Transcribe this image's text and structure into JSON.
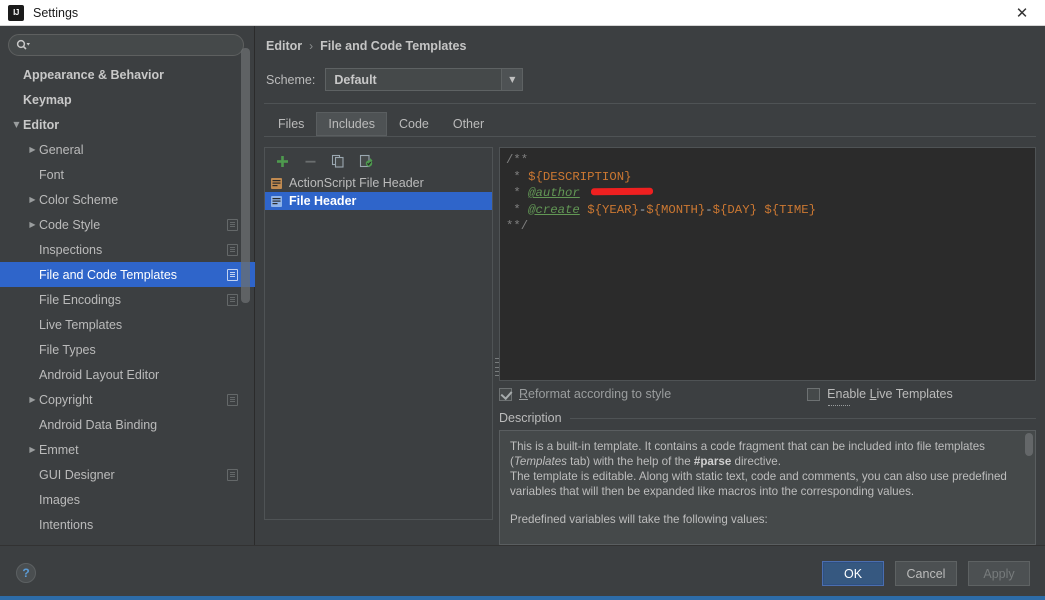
{
  "window": {
    "title": "Settings",
    "app_icon": "intellij-logo-icon",
    "close_icon": "✕"
  },
  "sidebar": {
    "search": {
      "placeholder": "",
      "value": "",
      "icon": "search-icon"
    },
    "items": [
      {
        "label": "Appearance & Behavior",
        "indent": 0,
        "arrow": "",
        "bold": true,
        "selected": false,
        "badge": false
      },
      {
        "label": "Keymap",
        "indent": 0,
        "arrow": "",
        "bold": true,
        "selected": false,
        "badge": false
      },
      {
        "label": "Editor",
        "indent": 0,
        "arrow": "▼",
        "bold": true,
        "selected": false,
        "badge": false
      },
      {
        "label": "General",
        "indent": 1,
        "arrow": "▶",
        "bold": false,
        "selected": false,
        "badge": false
      },
      {
        "label": "Font",
        "indent": 1,
        "arrow": "",
        "bold": false,
        "selected": false,
        "badge": false
      },
      {
        "label": "Color Scheme",
        "indent": 1,
        "arrow": "▶",
        "bold": false,
        "selected": false,
        "badge": false
      },
      {
        "label": "Code Style",
        "indent": 1,
        "arrow": "▶",
        "bold": false,
        "selected": false,
        "badge": true
      },
      {
        "label": "Inspections",
        "indent": 1,
        "arrow": "",
        "bold": false,
        "selected": false,
        "badge": true
      },
      {
        "label": "File and Code Templates",
        "indent": 1,
        "arrow": "",
        "bold": false,
        "selected": true,
        "badge": true
      },
      {
        "label": "File Encodings",
        "indent": 1,
        "arrow": "",
        "bold": false,
        "selected": false,
        "badge": true
      },
      {
        "label": "Live Templates",
        "indent": 1,
        "arrow": "",
        "bold": false,
        "selected": false,
        "badge": false
      },
      {
        "label": "File Types",
        "indent": 1,
        "arrow": "",
        "bold": false,
        "selected": false,
        "badge": false
      },
      {
        "label": "Android Layout Editor",
        "indent": 1,
        "arrow": "",
        "bold": false,
        "selected": false,
        "badge": false
      },
      {
        "label": "Copyright",
        "indent": 1,
        "arrow": "▶",
        "bold": false,
        "selected": false,
        "badge": true
      },
      {
        "label": "Android Data Binding",
        "indent": 1,
        "arrow": "",
        "bold": false,
        "selected": false,
        "badge": false
      },
      {
        "label": "Emmet",
        "indent": 1,
        "arrow": "▶",
        "bold": false,
        "selected": false,
        "badge": false
      },
      {
        "label": "GUI Designer",
        "indent": 1,
        "arrow": "",
        "bold": false,
        "selected": false,
        "badge": true
      },
      {
        "label": "Images",
        "indent": 1,
        "arrow": "",
        "bold": false,
        "selected": false,
        "badge": false
      },
      {
        "label": "Intentions",
        "indent": 1,
        "arrow": "",
        "bold": false,
        "selected": false,
        "badge": false
      }
    ]
  },
  "main": {
    "breadcrumb": {
      "parent": "Editor",
      "separator": "›",
      "current": "File and Code Templates"
    },
    "scheme": {
      "label": "Scheme:",
      "value": "Default",
      "arrow": "▼"
    },
    "tabs": [
      {
        "label": "Files",
        "active": false
      },
      {
        "label": "Includes",
        "active": true
      },
      {
        "label": "Code",
        "active": false
      },
      {
        "label": "Other",
        "active": false
      }
    ],
    "list_toolbar": [
      {
        "name": "add-template-button",
        "icon": "plus-icon",
        "enabled": true
      },
      {
        "name": "remove-template-button",
        "icon": "minus-icon",
        "enabled": false
      },
      {
        "name": "copy-template-button",
        "icon": "copy-icon",
        "enabled": true
      },
      {
        "name": "reset-template-button",
        "icon": "reset-icon",
        "enabled": true
      }
    ],
    "templates": [
      {
        "label": "ActionScript File Header",
        "selected": false,
        "icon": "actionscript-file-icon"
      },
      {
        "label": "File Header",
        "selected": true,
        "icon": "file-header-icon"
      }
    ],
    "editor": {
      "lines": [
        {
          "segments": [
            {
              "text": "/**",
              "cls": "c-comment"
            }
          ]
        },
        {
          "segments": [
            {
              "text": " * ",
              "cls": "c-comment"
            },
            {
              "text": "${DESCRIPTION}",
              "cls": "c-var"
            }
          ]
        },
        {
          "segments": [
            {
              "text": " * ",
              "cls": "c-comment"
            },
            {
              "text": "@author",
              "cls": "c-tag"
            },
            {
              "text": " ",
              "cls": "c-comment"
            },
            {
              "text": "",
              "cls": "redact"
            }
          ]
        },
        {
          "segments": [
            {
              "text": " * ",
              "cls": "c-comment"
            },
            {
              "text": "@create",
              "cls": "c-tag"
            },
            {
              "text": " ",
              "cls": "c-comment"
            },
            {
              "text": "${YEAR}",
              "cls": "c-var"
            },
            {
              "text": "-",
              "cls": "c-dash"
            },
            {
              "text": "${MONTH}",
              "cls": "c-var"
            },
            {
              "text": "-",
              "cls": "c-dash"
            },
            {
              "text": "${DAY}",
              "cls": "c-var"
            },
            {
              "text": " ",
              "cls": "c-comment"
            },
            {
              "text": "${TIME}",
              "cls": "c-var"
            }
          ]
        },
        {
          "segments": [
            {
              "text": "**/",
              "cls": "c-comment"
            }
          ]
        }
      ]
    },
    "options": {
      "reformat": {
        "label_before": "",
        "mnemonic": "R",
        "label_after": "eformat according to style",
        "checked": true,
        "enabled": false
      },
      "live_templates": {
        "label_before": "Enable ",
        "mnemonic": "L",
        "label_after": "ive Templates",
        "checked": false,
        "enabled": true
      }
    },
    "description": {
      "title": "Description",
      "paragraph1_a": "This is a built-in template. It contains a code fragment that can be included into file templates (",
      "paragraph1_italic": "Templates",
      "paragraph1_b": " tab) with the help of the ",
      "paragraph1_bold": "#parse",
      "paragraph1_c": " directive.",
      "paragraph2": "The template is editable. Along with static text, code and comments, you can also use predefined variables that will then be expanded like macros into the corresponding values.",
      "paragraph3": "Predefined variables will take the following values:"
    }
  },
  "footer": {
    "help": "?",
    "ok": "OK",
    "cancel": "Cancel",
    "apply": "Apply"
  },
  "colors": {
    "selection_blue": "#2f65ca",
    "primary_button": "#365880",
    "editor_bg": "#2b2b2b",
    "panel_bg": "#3c3f41",
    "redaction_red": "#ef2020",
    "variable_orange": "#cc7832",
    "tag_green": "#629755"
  }
}
